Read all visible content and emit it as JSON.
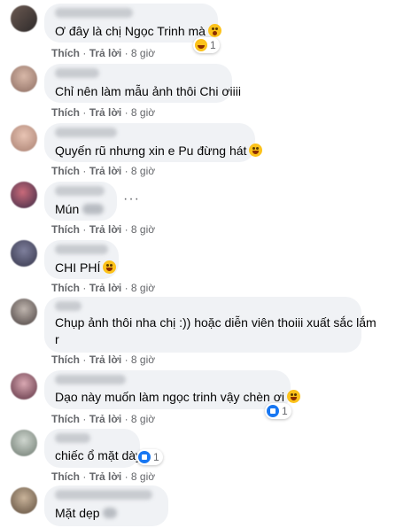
{
  "actions": {
    "like": "Thích",
    "dot": "·",
    "reply": "Trả lời",
    "time": "8 giờ"
  },
  "comments": [
    {
      "text": "Ơ đây là chị Ngọc Trinh mà",
      "reaction_count": "1"
    },
    {
      "text": "Chỉ nên làm mẫu ảnh thôi Chi ơiiii"
    },
    {
      "text": "Quyến rũ nhưng xin e Pu đừng hát"
    },
    {
      "text": "Mún"
    },
    {
      "text": "CHI PHÍ"
    },
    {
      "text": "Chụp ảnh thôi nha chị :)) hoặc diễn viên thoiii xuất sắc lắm",
      "text2": "r"
    },
    {
      "text": "Dạo này muốn làm ngọc trinh vậy chèn ơi",
      "reaction_count": "1"
    },
    {
      "text": "chiếc ổ mặt dày",
      "reaction_count": "1"
    },
    {
      "text": "Mặt dẹp"
    }
  ],
  "more_options": "···",
  "colors": {
    "bubble": "#f0f2f5",
    "meta": "#65676b",
    "text": "#050505",
    "like_blue": "#1877f2"
  }
}
